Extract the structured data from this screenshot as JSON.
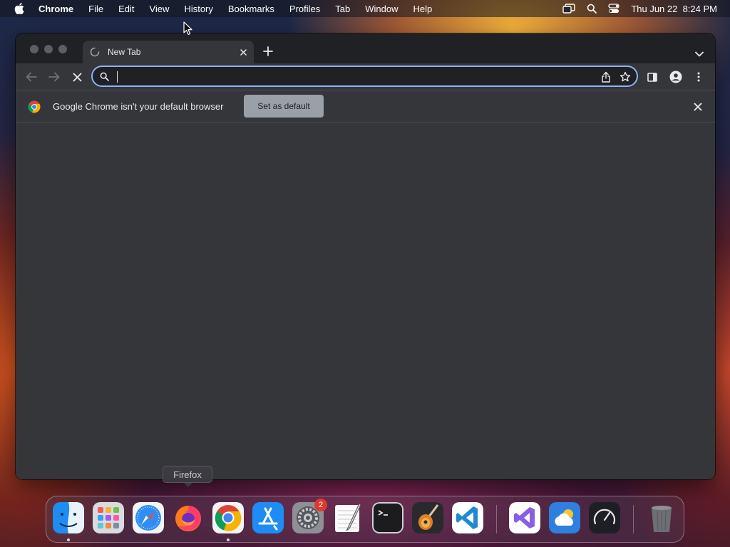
{
  "menubar": {
    "app_name": "Chrome",
    "items": [
      "File",
      "Edit",
      "View",
      "History",
      "Bookmarks",
      "Profiles",
      "Tab",
      "Window",
      "Help"
    ],
    "clock": "Thu Jun 22  8:24 PM"
  },
  "browser": {
    "tab": {
      "title": "New Tab",
      "loading": true
    },
    "omnibox": {
      "value": ""
    },
    "infobar": {
      "message": "Google Chrome isn't your default browser",
      "button_label": "Set as default"
    }
  },
  "dock": {
    "tooltip": "Firefox",
    "apps": [
      {
        "name": "Finder",
        "running": true
      },
      {
        "name": "Launchpad",
        "running": false
      },
      {
        "name": "Safari",
        "running": false
      },
      {
        "name": "Firefox",
        "running": false
      },
      {
        "name": "Chrome",
        "running": true
      },
      {
        "name": "App Store",
        "running": false
      },
      {
        "name": "System Settings",
        "running": false,
        "badge": "2"
      },
      {
        "name": "TextEdit",
        "running": false
      },
      {
        "name": "Terminal",
        "running": false
      },
      {
        "name": "GarageBand",
        "running": false
      },
      {
        "name": "Visual Studio Code",
        "running": false
      },
      {
        "name": "Visual Studio",
        "running": false
      },
      {
        "name": "Weather",
        "running": false
      },
      {
        "name": "Activity Monitor",
        "running": false
      },
      {
        "name": "Trash",
        "running": false
      }
    ]
  },
  "colors": {
    "window_bg": "#35363a",
    "tabstrip_bg": "#202124",
    "focus_ring": "#8ab4f8",
    "text": "#e8eaed",
    "badge": "#e0382d"
  }
}
